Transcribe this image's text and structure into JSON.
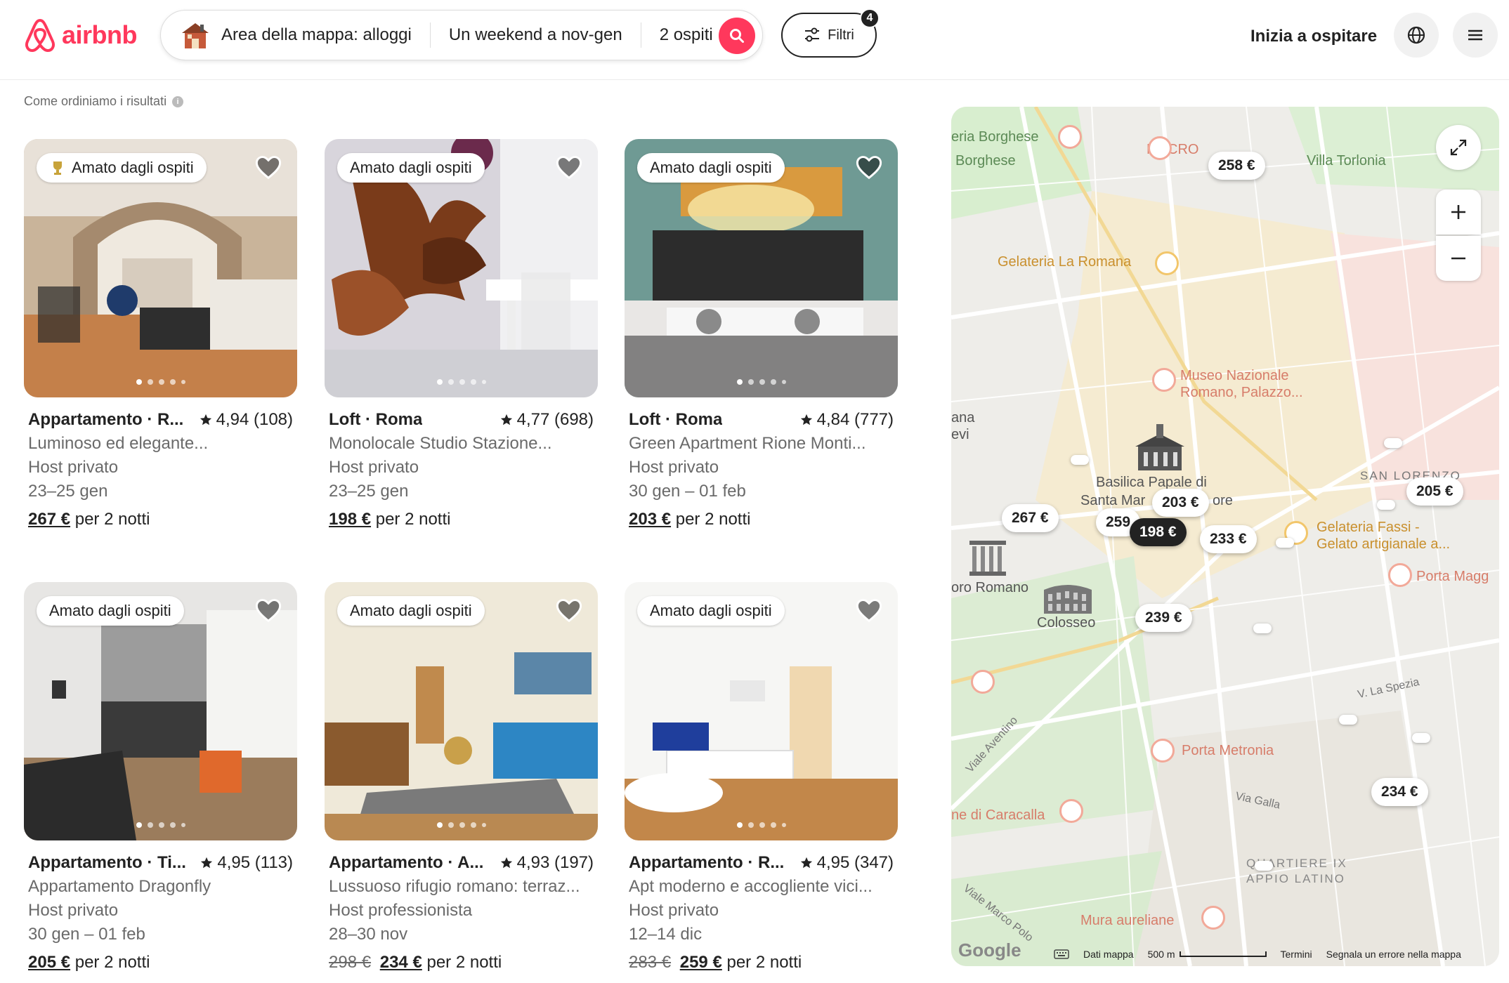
{
  "header": {
    "logo_text": "airbnb",
    "search": {
      "location": "Area della mappa: alloggi",
      "dates": "Un weekend a nov-gen",
      "guests": "2 ospiti"
    },
    "filters_label": "Filtri",
    "filters_count": "4",
    "host_label": "Inizia a ospitare",
    "brand_color": "#ff385c"
  },
  "results": {
    "sort_info": "Come ordiniamo i risultati"
  },
  "listings": [
    {
      "badge": "Amato dagli ospiti",
      "title": "Appartamento · R...",
      "rating": "4,94 (108)",
      "desc": "Luminoso ed elegante...",
      "host": "Host privato",
      "dates": "23–25 gen",
      "old_price": "",
      "price": "267 €",
      "per": "per 2 notti"
    },
    {
      "badge": "Amato dagli ospiti",
      "title": "Loft · Roma",
      "rating": "4,77 (698)",
      "desc": "Monolocale Studio Stazione...",
      "host": "Host privato",
      "dates": "23–25 gen",
      "old_price": "",
      "price": "198 €",
      "per": "per 2 notti"
    },
    {
      "badge": "Amato dagli ospiti",
      "title": "Loft · Roma",
      "rating": "4,84 (777)",
      "desc": "Green Apartment Rione Monti...",
      "host": "Host privato",
      "dates": "30 gen – 01 feb",
      "old_price": "",
      "price": "203 €",
      "per": "per 2 notti"
    },
    {
      "badge": "Amato dagli ospiti",
      "title": "Appartamento · Ti...",
      "rating": "4,95 (113)",
      "desc": "Appartamento Dragonfly",
      "host": "Host privato",
      "dates": "30 gen – 01 feb",
      "old_price": "",
      "price": "205 €",
      "per": "per 2 notti"
    },
    {
      "badge": "Amato dagli ospiti",
      "title": "Appartamento · A...",
      "rating": "4,93 (197)",
      "desc": "Lussuoso rifugio romano: terraz...",
      "host": "Host professionista",
      "dates": "28–30 nov",
      "old_price": "298 €",
      "price": "234 €",
      "per": "per 2 notti"
    },
    {
      "badge": "Amato dagli ospiti",
      "title": "Appartamento · R...",
      "rating": "4,95 (347)",
      "desc": "Apt moderno e accogliente vici...",
      "host": "Host privato",
      "dates": "12–14 dic",
      "old_price": "283 €",
      "price": "259 €",
      "per": "per 2 notti"
    }
  ],
  "map": {
    "labels": {
      "borghese1": "eria Borghese",
      "borghese2": "Borghese",
      "macro": "MACRO",
      "torlonia": "Villa Torlonia",
      "gelateria_romana": "Gelateria La Romana",
      "museo1": "Museo Nazionale",
      "museo2": "Romano, Palazzo...",
      "basilica1": "Basilica Papale di",
      "basilica2": "Santa Mar",
      "basilica3": "ore",
      "san_lorenzo": "SAN LORENZO",
      "fassi1": "Gelateria Fassi -",
      "fassi2": "Gelato artigianale a...",
      "foro": "oro Romano",
      "colosseo": "Colosseo",
      "porta_magg": "Porta Magg",
      "la_spezia": "V. La Spezia",
      "aventino": "Viale Aventino",
      "metronia": "Porta Metronia",
      "caracalla": "ne di Caracalla",
      "galla": "Via Galla",
      "quartiere1": "QUARTIERE IX",
      "quartiere2": "APPIO LATINO",
      "mura": "Mura aureliane",
      "marco_polo": "Viale Marco Polo",
      "nazionale1": "ana",
      "nazionale2": "evi",
      "google": "Google"
    },
    "pins": {
      "p258": "258 €",
      "p205": "205 €",
      "p267": "267 €",
      "p259": "259",
      "p203": "203 €",
      "p198": "198 €",
      "p233": "233 €",
      "p239": "239 €",
      "p234": "234 €"
    },
    "footer": {
      "data": "Dati mappa",
      "scale": "500 m",
      "terms": "Termini",
      "report": "Segnala un errore nella mappa"
    }
  }
}
